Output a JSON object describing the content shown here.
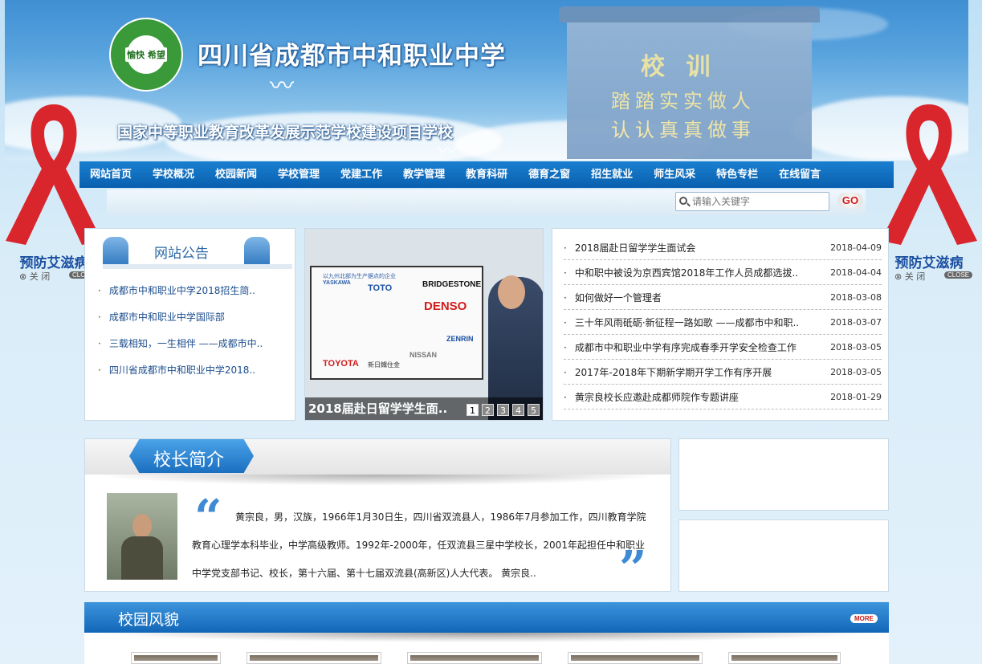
{
  "header": {
    "logo_text": "愉快 希望",
    "school_name": "四川省成都市中和职业中学",
    "subtitle": "国家中等职业教育改革发展示范学校建设项目学校",
    "motto_title": "校 训",
    "motto_lines": [
      "踏踏实实做人",
      "认认真真做事"
    ]
  },
  "nav": {
    "items": [
      "网站首页",
      "学校概况",
      "校园新闻",
      "学校管理",
      "党建工作",
      "教学管理",
      "教育科研",
      "德育之窗",
      "招生就业",
      "师生风采",
      "特色专栏",
      "在线留言"
    ]
  },
  "search": {
    "placeholder": "请输入关键字",
    "go_label": "GO"
  },
  "ribbon": {
    "text": "预防艾滋病",
    "close_label": "⊗ 关 闭",
    "close_badge": "CLOSE"
  },
  "notice": {
    "title": "网站公告",
    "items": [
      "成都市中和职业中学2018招生简..",
      "成都市中和职业中学国际部",
      "三载相知，一生相伴 ——成都市中..",
      "四川省成都市中和职业中学2018.."
    ]
  },
  "slideshow": {
    "caption": "2018届赴日留学学生面..",
    "board_header": "以九州北部为生产据点的企业",
    "brands": [
      "YASKAWA",
      "TOTO",
      "BRIDGESTONE",
      "DENSO",
      "ZENRIN",
      "TOYOTA",
      "新日鐵住金",
      "NISSAN"
    ],
    "pages": [
      "1",
      "2",
      "3",
      "4",
      "5"
    ],
    "active_page": 1
  },
  "news": {
    "items": [
      {
        "title": "2018届赴日留学学生面试会",
        "date": "2018-04-09"
      },
      {
        "title": "中和职中被设为京西宾馆2018年工作人员成都选拔..",
        "date": "2018-04-04"
      },
      {
        "title": "如何做好一个管理者",
        "date": "2018-03-08"
      },
      {
        "title": "三十年风雨砥砺·新征程一路如歌 ——成都市中和职..",
        "date": "2018-03-07"
      },
      {
        "title": "成都市中和职业中学有序完成春季开学安全检查工作",
        "date": "2018-03-05"
      },
      {
        "title": "2017年-2018年下期新学期开学工作有序开展",
        "date": "2018-03-05"
      },
      {
        "title": "黄宗良校长应邀赴成都师院作专题讲座",
        "date": "2018-01-29"
      }
    ]
  },
  "principal": {
    "title": "校长简介",
    "text": "黄宗良，男，汉族，1966年1月30日生，四川省双流县人，1986年7月参加工作，四川教育学院教育心理学本科毕业，中学高级教师。1992年-2000年，任双流县三星中学校长，2001年起担任中和职业中学党支部书记、校长，第十六届、第十七届双流县(高新区)人大代表。 黄宗良.."
  },
  "campus": {
    "title": "校园风貌",
    "more_label": "MORE"
  },
  "colors": {
    "nav_blue": "#0a5fae",
    "link_blue": "#1d4e8e",
    "ribbon_red": "#d8262c"
  }
}
